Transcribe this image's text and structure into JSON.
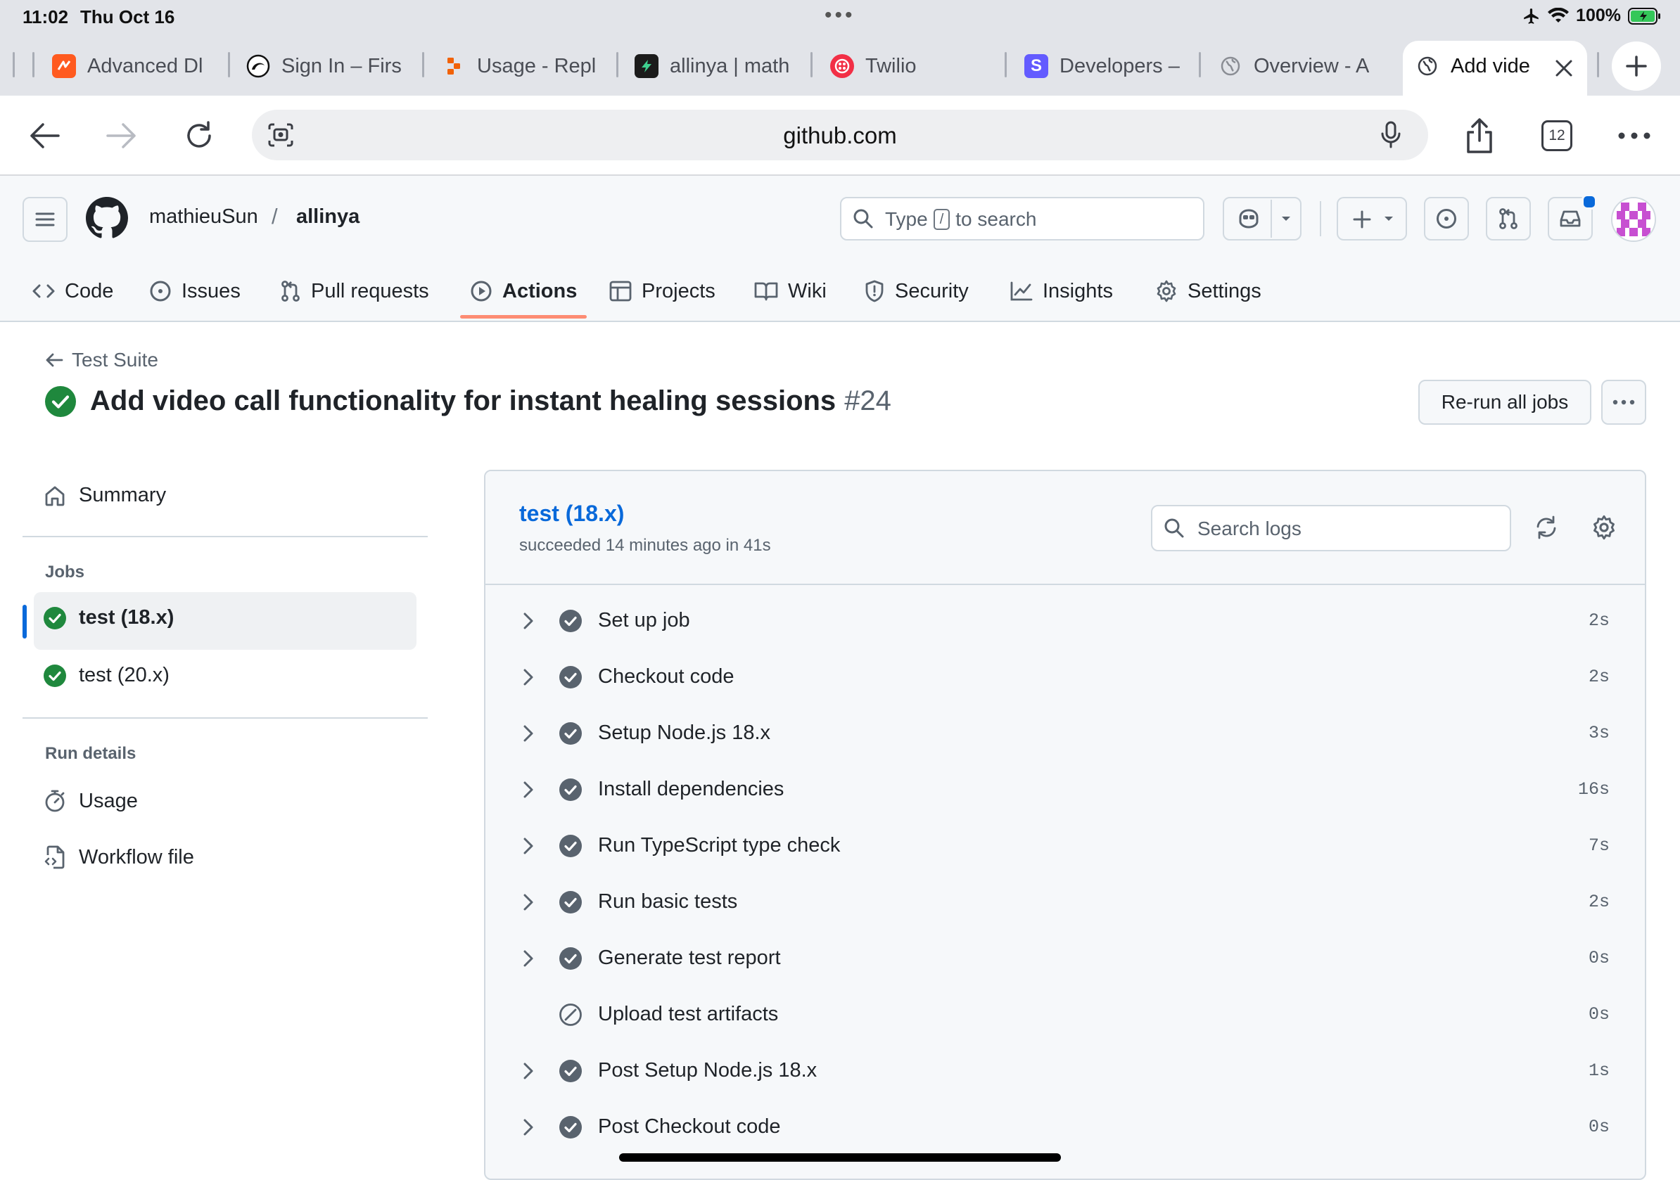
{
  "status_bar": {
    "time": "11:02",
    "date": "Thu Oct 16",
    "battery": "100%"
  },
  "tabs": [
    {
      "title": "Advanced Dl",
      "icon": "orange-bolt-icon",
      "color": "#ff5a1f"
    },
    {
      "title": "Sign In – Firs",
      "icon": "black-swirl-icon",
      "color": "#111111"
    },
    {
      "title": "Usage - Repl",
      "icon": "replit-icon",
      "color": "#f26207"
    },
    {
      "title": "allinya | math",
      "icon": "green-bolt-icon",
      "color": "#1b1b1b"
    },
    {
      "title": "Twilio",
      "icon": "twilio-icon",
      "color": "#f22f46"
    },
    {
      "title": "Developers –",
      "icon": "stripe-s-icon",
      "color": "#635bff"
    },
    {
      "title": "Overview - A",
      "icon": "globe-icon",
      "color": "#8a8d94"
    },
    {
      "title": "Add vide",
      "icon": "globe-icon",
      "color": "#3a3d44"
    }
  ],
  "browser": {
    "url": "github.com",
    "tab_count": "12"
  },
  "repo": {
    "owner": "mathieuSun",
    "name": "allinya"
  },
  "search": {
    "before": "Type",
    "key": "/",
    "after": "to search"
  },
  "nav": [
    {
      "label": "Code",
      "icon": "code-icon"
    },
    {
      "label": "Issues",
      "icon": "issue-icon"
    },
    {
      "label": "Pull requests",
      "icon": "pull-request-icon"
    },
    {
      "label": "Actions",
      "icon": "play-icon"
    },
    {
      "label": "Projects",
      "icon": "table-icon"
    },
    {
      "label": "Wiki",
      "icon": "book-icon"
    },
    {
      "label": "Security",
      "icon": "shield-icon"
    },
    {
      "label": "Insights",
      "icon": "graph-icon"
    },
    {
      "label": "Settings",
      "icon": "gear-icon"
    }
  ],
  "run": {
    "back_label": "Test Suite",
    "title": "Add video call functionality for instant healing sessions",
    "number": "#24",
    "rerun_label": "Re-run all jobs"
  },
  "sidebar": {
    "summary": "Summary",
    "jobs_heading": "Jobs",
    "jobs": [
      {
        "label": "test (18.x)",
        "status": "success",
        "selected": true
      },
      {
        "label": "test (20.x)",
        "status": "success",
        "selected": false
      }
    ],
    "run_details_heading": "Run details",
    "usage": "Usage",
    "workflow_file": "Workflow file"
  },
  "job": {
    "name": "test (18.x)",
    "status_text": "succeeded 14 minutes ago in 41s",
    "search_placeholder": "Search logs",
    "steps": [
      {
        "name": "Set up job",
        "duration": "2s",
        "status": "success"
      },
      {
        "name": "Checkout code",
        "duration": "2s",
        "status": "success"
      },
      {
        "name": "Setup Node.js 18.x",
        "duration": "3s",
        "status": "success"
      },
      {
        "name": "Install dependencies",
        "duration": "16s",
        "status": "success"
      },
      {
        "name": "Run TypeScript type check",
        "duration": "7s",
        "status": "success"
      },
      {
        "name": "Run basic tests",
        "duration": "2s",
        "status": "success"
      },
      {
        "name": "Generate test report",
        "duration": "0s",
        "status": "success"
      },
      {
        "name": "Upload test artifacts",
        "duration": "0s",
        "status": "skipped"
      },
      {
        "name": "Post Setup Node.js 18.x",
        "duration": "1s",
        "status": "success"
      },
      {
        "name": "Post Checkout code",
        "duration": "0s",
        "status": "success"
      }
    ]
  },
  "colors": {
    "success": "#1f883d",
    "link": "#0969da",
    "underline": "#fd8c73"
  }
}
